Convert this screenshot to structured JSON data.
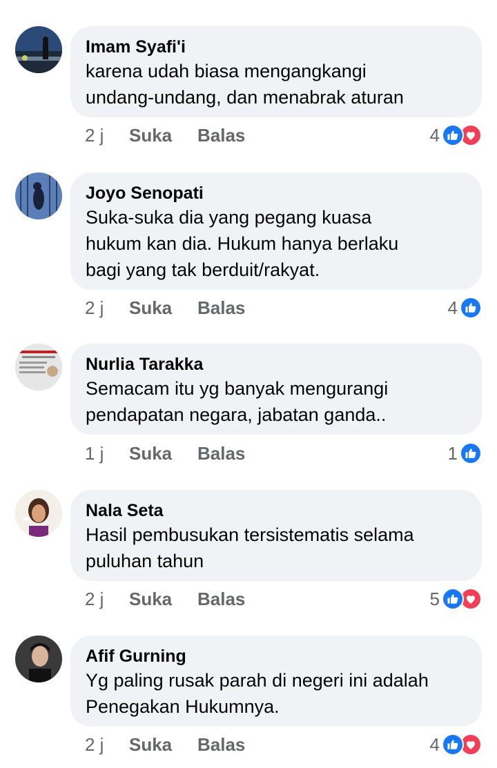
{
  "comments": [
    {
      "author": "Imam Syafi'i",
      "lines": [
        "karena udah biasa mengangkangi",
        "undang-undang, dan menabrak aturan"
      ],
      "time": "2 j",
      "like_label": "Suka",
      "reply_label": "Balas",
      "reaction_count": "4",
      "reactions": [
        "like-icon",
        "love-icon"
      ]
    },
    {
      "author": "Joyo Senopati",
      "lines": [
        "Suka-suka dia yang pegang kuasa",
        "hukum kan dia. Hukum hanya berlaku",
        "bagi yang tak berduit/rakyat."
      ],
      "time": "2 j",
      "like_label": "Suka",
      "reply_label": "Balas",
      "reaction_count": "4",
      "reactions": [
        "like-icon"
      ]
    },
    {
      "author": "Nurlia Tarakka",
      "lines": [
        "Semacam itu yg banyak mengurangi",
        "pendapatan negara, jabatan ganda.."
      ],
      "time": "1 j",
      "like_label": "Suka",
      "reply_label": "Balas",
      "reaction_count": "1",
      "reactions": [
        "like-icon"
      ]
    },
    {
      "author": "Nala Seta",
      "lines": [
        "Hasil pembusukan tersistematis selama",
        "puluhan tahun"
      ],
      "time": "2 j",
      "like_label": "Suka",
      "reply_label": "Balas",
      "reaction_count": "5",
      "reactions": [
        "like-icon",
        "love-icon"
      ]
    },
    {
      "author": "Afif Gurning",
      "lines": [
        "Yg paling rusak parah di negeri ini adalah",
        "Penegakan Hukumnya."
      ],
      "time": "2 j",
      "like_label": "Suka",
      "reply_label": "Balas",
      "reaction_count": "4",
      "reactions": [
        "like-icon",
        "love-icon"
      ]
    }
  ],
  "colors": {
    "bubble": "#f0f2f5",
    "secondary_text": "#65676b",
    "like": "#1877f2",
    "love": "#f33e58"
  }
}
